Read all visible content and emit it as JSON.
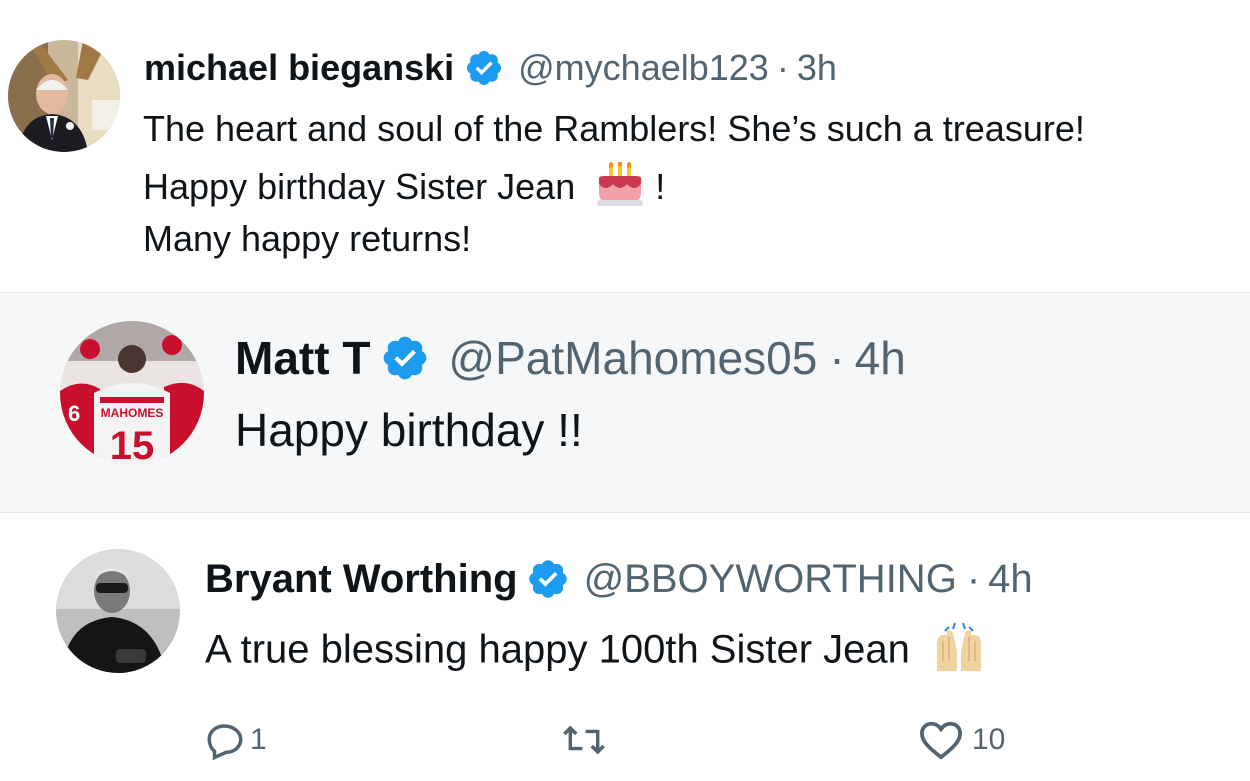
{
  "tweets": [
    {
      "name": "michael bieganski",
      "handle": "@mychaelb123",
      "separator": "·",
      "time": "3h",
      "verified": true,
      "lines": [
        "The heart and soul of the Ramblers!  She’s such a treasure!",
        "Happy birthday Sister Jean",
        "!",
        "Many happy returns!"
      ],
      "emoji": "birthday-cake"
    },
    {
      "name": "Matt T",
      "handle": "@PatMahomes05",
      "separator": "·",
      "time": "4h",
      "verified": true,
      "lines": [
        "Happy birthday !!"
      ],
      "avatar_jersey_text": "MAHOMES",
      "avatar_jersey_number": "15",
      "avatar_side_number": "6"
    },
    {
      "name": "Bryant Worthing",
      "handle": "@BBOYWORTHING",
      "separator": "·",
      "time": "4h",
      "verified": true,
      "lines": [
        "A true blessing happy 100th Sister Jean"
      ],
      "emoji": "raising-hands",
      "actions": {
        "reply_count": "1",
        "retweet_count": "",
        "like_count": "10"
      }
    }
  ],
  "colors": {
    "verified_blue": "#1d9bf0",
    "text_primary": "#0f1419",
    "text_secondary": "#536471",
    "chiefs_red": "#c8102e"
  }
}
